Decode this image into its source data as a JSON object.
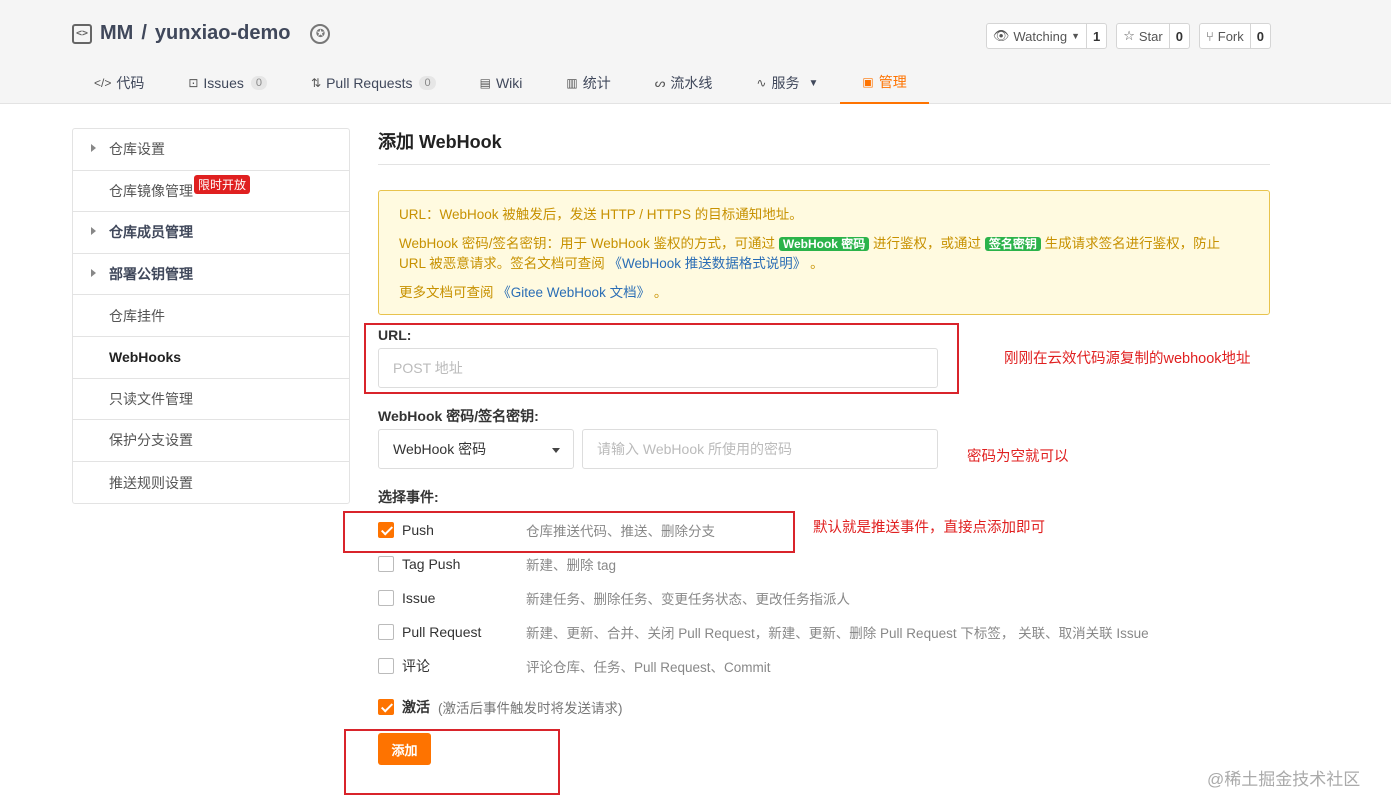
{
  "repo": {
    "owner": "MM",
    "separator": "/",
    "name": "yunxiao-demo"
  },
  "actions": [
    {
      "label": "Watching",
      "count": "1"
    },
    {
      "label": "Star",
      "count": "0"
    },
    {
      "label": "Fork",
      "count": "0"
    }
  ],
  "tabs": [
    {
      "label": "代码"
    },
    {
      "label": "Issues",
      "count": "0"
    },
    {
      "label": "Pull Requests",
      "count": "0"
    },
    {
      "label": "Wiki"
    },
    {
      "label": "统计"
    },
    {
      "label": "流水线"
    },
    {
      "label": "服务"
    },
    {
      "label": "管理"
    }
  ],
  "sidebar": {
    "items": [
      {
        "label": "仓库设置"
      },
      {
        "label": "仓库镜像管理",
        "badge": "限时开放"
      },
      {
        "label": "仓库成员管理"
      },
      {
        "label": "部署公钥管理"
      },
      {
        "label": "仓库挂件"
      },
      {
        "label": "WebHooks"
      },
      {
        "label": "只读文件管理"
      },
      {
        "label": "保护分支设置"
      },
      {
        "label": "推送规则设置"
      }
    ]
  },
  "main": {
    "title": "添加 WebHook",
    "notice": {
      "line1": "URL：WebHook 被触发后，发送 HTTP / HTTPS 的目标通知地址。",
      "line2_a": "WebHook 密码/签名密钥：用于 WebHook 鉴权的方式，可通过",
      "tag1": "WebHook 密码",
      "line2_b": "进行鉴权，或通过",
      "tag2": "签名密钥",
      "line2_c": "生成请求签名进行鉴权，防止 URL 被恶意请求。签名文档可查阅",
      "link1": "《WebHook 推送数据格式说明》",
      "line2_d": "。",
      "line3_a": "更多文档可查阅",
      "link2": "《Gitee WebHook 文档》",
      "line3_b": "。"
    },
    "url_label": "URL:",
    "url_placeholder": "POST 地址",
    "secret_label": "WebHook 密码/签名密钥:",
    "secret_select": "WebHook 密码",
    "secret_placeholder": "请输入 WebHook 所使用的密码",
    "events_label": "选择事件:",
    "events": [
      {
        "name": "Push",
        "desc": "仓库推送代码、推送、删除分支",
        "checked": true
      },
      {
        "name": "Tag Push",
        "desc": "新建、删除 tag",
        "checked": false
      },
      {
        "name": "Issue",
        "desc": "新建任务、删除任务、变更任务状态、更改任务指派人",
        "checked": false
      },
      {
        "name": "Pull Request",
        "desc": "新建、更新、合并、关闭 Pull Request，新建、更新、删除 Pull Request 下标签， 关联、取消关联 Issue",
        "checked": false
      },
      {
        "name": "评论",
        "desc": "评论仓库、任务、Pull Request、Commit",
        "checked": false
      }
    ],
    "activate_label": "激活",
    "activate_hint": "(激活后事件触发时将发送请求)",
    "add_button": "添加"
  },
  "annotations": {
    "url_note": "刚刚在云效代码源复制的webhook地址",
    "secret_note": "密码为空就可以",
    "push_note": "默认就是推送事件，直接点添加即可"
  },
  "watermark": "@稀土掘金技术社区",
  "colors": {
    "accent": "#fe7300",
    "annotation": "#d9242b",
    "notice_bg": "#fffae0",
    "tag_green": "#2bb34a"
  }
}
